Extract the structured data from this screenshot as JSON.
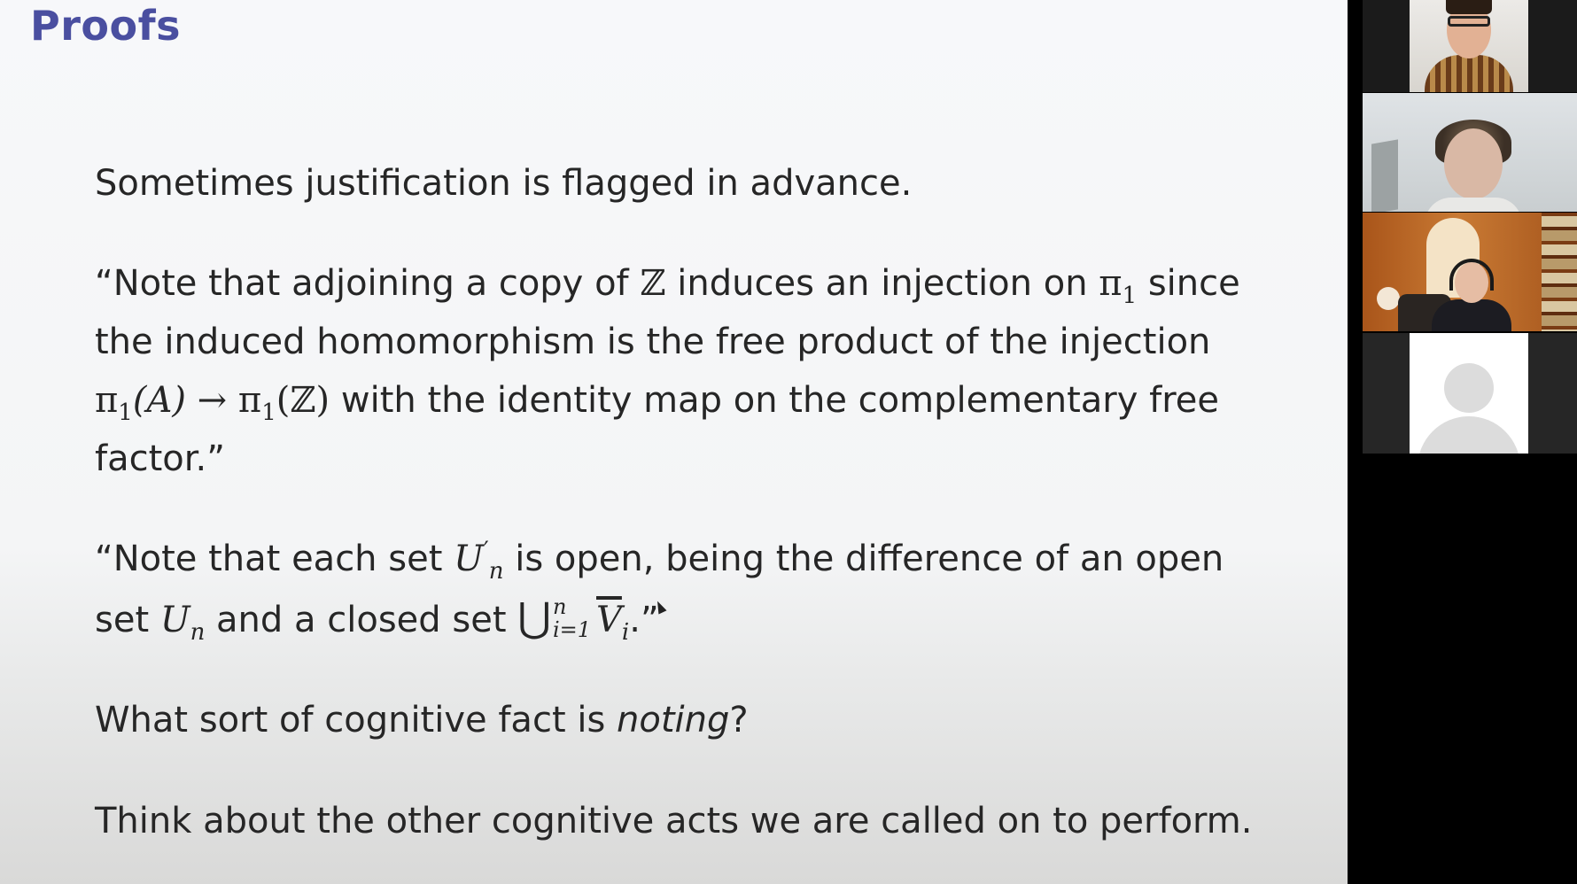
{
  "slide": {
    "title": "Proofs",
    "p1": "Sometimes justification is flagged in advance.",
    "p2": {
      "open_quote": "“Note that adjoining a copy of ",
      "Z": "ℤ",
      "mid1": " induces an injection on ",
      "pi": "π",
      "one": "1",
      "mid2": " since the induced homomorphism is the free product of the injection ",
      "pi1A": "(A)",
      "arrow": " → ",
      "pi1Z": "(ℤ)",
      "end": " with the identity map on the complementary free factor.”"
    },
    "p3": {
      "open_quote": "“Note that each set ",
      "U": "U",
      "prime": "′",
      "n": "n",
      "mid": " is open, being the difference of an open set ",
      "mid2": " and a closed set ",
      "bigcup": "⋃",
      "sup": "n",
      "sub": "i=1",
      "V": "V",
      "i": "i",
      "close": ".”"
    },
    "p4": {
      "start": "What sort of cognitive fact is ",
      "emph": "noting",
      "end": "?"
    },
    "p5": "Think about the other cognitive acts we are called on to perform."
  },
  "participants": [
    {
      "id": "participant-1"
    },
    {
      "id": "participant-2"
    },
    {
      "id": "participant-3"
    },
    {
      "id": "participant-4"
    }
  ]
}
